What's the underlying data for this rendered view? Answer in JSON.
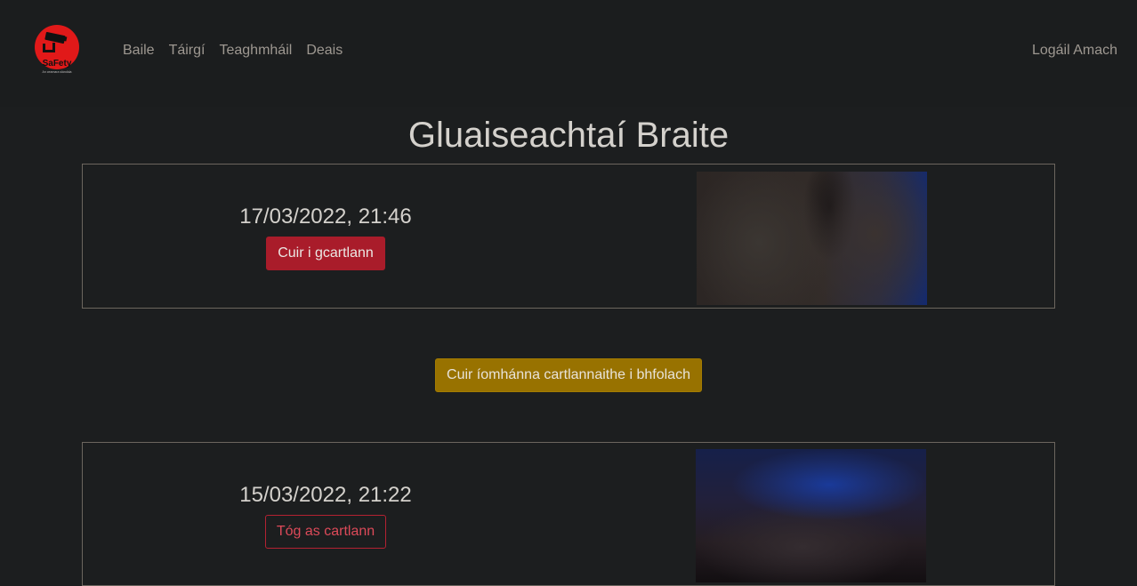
{
  "nav": {
    "logo_text": "SaFety",
    "logo_subtitle": "An ceamara slándála",
    "links": [
      "Baile",
      "Táirgí",
      "Teaghmháil",
      "Deais"
    ],
    "logout": "Logáil Amach"
  },
  "page": {
    "title": "Gluaiseachtaí Braite"
  },
  "detections": [
    {
      "timestamp": "17/03/2022, 21:46",
      "action_label": "Cuir i gcartlann",
      "archived": false,
      "thumbnail": "motion-snapshot-image"
    },
    {
      "timestamp": "15/03/2022, 21:22",
      "action_label": "Tóg as cartlann",
      "archived": true,
      "thumbnail": "motion-snapshot-image"
    }
  ],
  "archive_toggle": {
    "label": "Cuir íomhánna cartlannaithe i bhfolach"
  },
  "colors": {
    "background": "#1c1e1f",
    "danger": "#a91c2a",
    "warning": "#987200",
    "logo_red": "#e11919"
  }
}
